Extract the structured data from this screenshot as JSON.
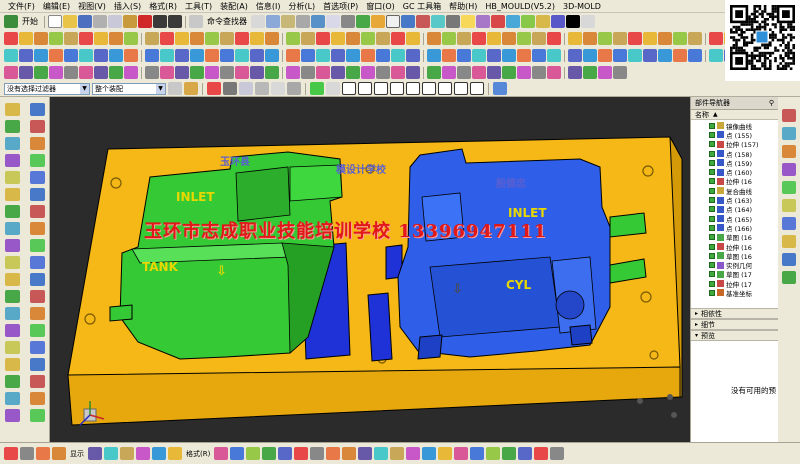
{
  "menu": [
    "文件(F)",
    "编辑(E)",
    "视图(V)",
    "插入(S)",
    "格式(R)",
    "工具(T)",
    "装配(A)",
    "信息(I)",
    "分析(L)",
    "首选项(P)",
    "窗口(O)",
    "GC 工具箱",
    "帮助(H)",
    "HB_MOULD(V5.2)",
    "3D-MOLD"
  ],
  "toolbar": {
    "start_label": "开始",
    "command_finder_label": "命令查找器"
  },
  "filters": {
    "selection_filter": "没有选择过滤器",
    "assembly_scope": "整个装配"
  },
  "viewport": {
    "watermark": "玉环市志成职业技能培训学校  13396947111",
    "plate_text_left": "玉环县",
    "plate_text_center": "模设计学校",
    "plate_text_right": "殷德忠",
    "left_part_labels": [
      "INLET",
      "TANK"
    ],
    "right_part_labels": [
      "INLET",
      "CYL"
    ],
    "colors": {
      "background": "#2b2b2b",
      "plate": "#f5b816",
      "left_part": "#35c935",
      "right_part": "#2f5fe8",
      "inserts": "#1e32d8"
    }
  },
  "navigator": {
    "title": "部件导航器",
    "column_header": "名称",
    "tree": [
      "镜像曲线",
      "点 (155)",
      "拉伸 (157)",
      "点 (158)",
      "点 (159)",
      "点 (160)",
      "拉伸 (16",
      "复合曲线",
      "点 (163)",
      "点 (164)",
      "点 (165)",
      "点 (166)",
      "草图 (16",
      "拉伸 (16",
      "草图 (16",
      "实例几何",
      "草图 (17",
      "拉伸 (17",
      "基准坐标"
    ],
    "sections": {
      "dependencies": "相依性",
      "details": "细节",
      "preview": "预览"
    },
    "preview_empty": "没有可用的预"
  },
  "bottom_toolbar": {
    "items": [
      "显示",
      "格式(R)"
    ]
  }
}
